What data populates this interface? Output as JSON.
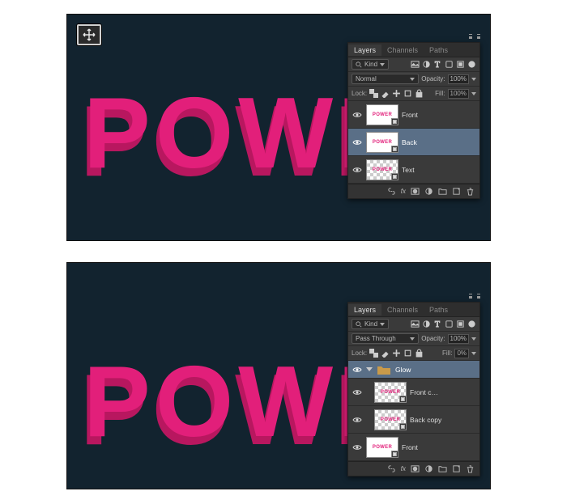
{
  "canvas_text": "POWER",
  "top": {
    "tabs": {
      "layers": "Layers",
      "channels": "Channels",
      "paths": "Paths"
    },
    "filter": {
      "kind": "Kind"
    },
    "blend": {
      "mode": "Normal",
      "opacity_label": "Opacity:",
      "opacity_value": "100%"
    },
    "lock": {
      "label": "Lock:",
      "fill_label": "Fill:",
      "fill_value": "100%"
    },
    "layers": [
      {
        "name": "Front",
        "thumb_text": "POWER",
        "checker": false
      },
      {
        "name": "Back",
        "thumb_text": "POWER",
        "checker": false,
        "selected": true
      },
      {
        "name": "Text",
        "thumb_text": "POWER",
        "checker": true
      }
    ]
  },
  "bot": {
    "tabs": {
      "layers": "Layers",
      "channels": "Channels",
      "paths": "Paths"
    },
    "filter": {
      "kind": "Kind"
    },
    "blend": {
      "mode": "Pass Through",
      "opacity_label": "Opacity:",
      "opacity_value": "100%"
    },
    "lock": {
      "label": "Lock:",
      "fill_label": "Fill:",
      "fill_value": "0%"
    },
    "group": {
      "name": "Glow"
    },
    "layers": [
      {
        "name": "Front c…",
        "thumb_text": "POWER",
        "checker": true
      },
      {
        "name": "Back copy",
        "thumb_text": "POWER",
        "checker": true
      },
      {
        "name": "Front",
        "thumb_text": "POWER",
        "checker": false
      }
    ]
  }
}
